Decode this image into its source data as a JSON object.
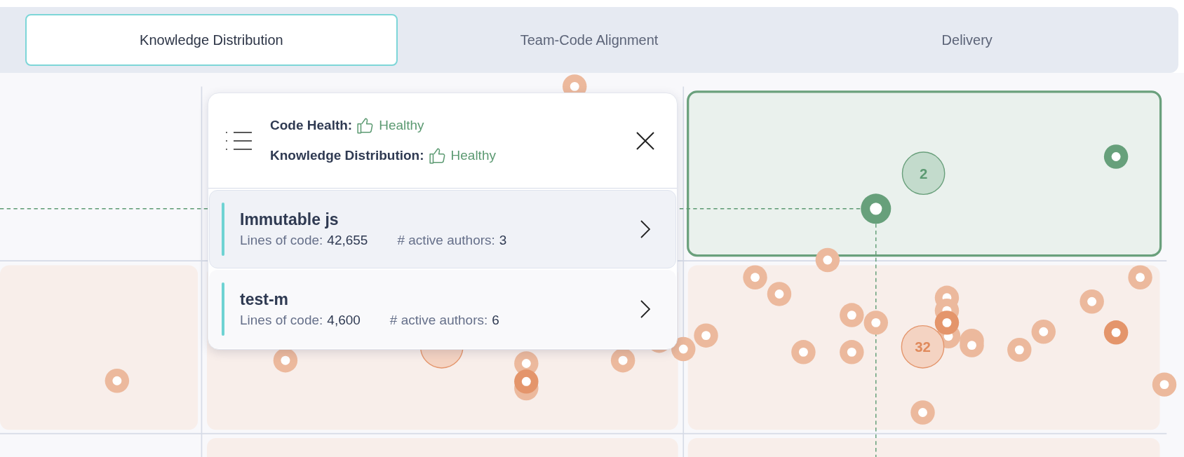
{
  "tabs": [
    {
      "label": "Knowledge Distribution",
      "selected": true
    },
    {
      "label": "Team-Code Alignment",
      "selected": false
    },
    {
      "label": "Delivery",
      "selected": false
    }
  ],
  "chart": {
    "clusters": [
      {
        "label": "2",
        "kind": "healthy"
      },
      {
        "label": "32",
        "kind": "unhealthy"
      }
    ]
  },
  "popup": {
    "status": [
      {
        "label": "Code Health:",
        "value": "Healthy"
      },
      {
        "label": "Knowledge Distribution:",
        "value": "Healthy"
      }
    ],
    "items": [
      {
        "name": "Immutable js",
        "loc_label": "Lines of code:",
        "loc": "42,655",
        "authors_label": "# active authors:",
        "authors": "3",
        "selected": true
      },
      {
        "name": "test-m",
        "loc_label": "Lines of code:",
        "loc": "4,600",
        "authors_label": "# active authors:",
        "authors": "6",
        "selected": false
      }
    ]
  }
}
